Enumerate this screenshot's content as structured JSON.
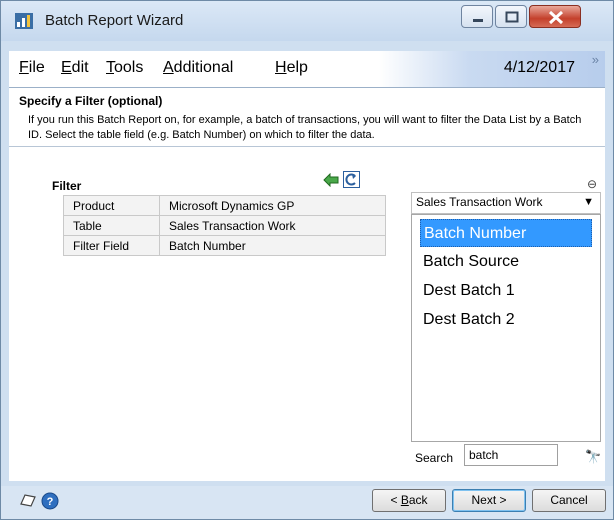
{
  "window": {
    "title": "Batch Report Wizard"
  },
  "menu": {
    "items": [
      {
        "label": "File",
        "u": "F",
        "rest": "ile"
      },
      {
        "label": "Edit",
        "u": "E",
        "rest": "dit"
      },
      {
        "label": "Tools",
        "u": "T",
        "rest": "ools"
      },
      {
        "label": "Additional",
        "u": "A",
        "rest": "dditional"
      },
      {
        "label": "Help",
        "u": "H",
        "rest": "elp"
      }
    ],
    "date": "4/12/2017",
    "overflow": "»"
  },
  "header": {
    "title": "Specify a Filter (optional)",
    "description": "If you run this Batch Report on, for example, a batch of transactions, you will want to filter the Data List by a Batch ID.  Select the table field (e.g. Batch Number) on which to filter the data."
  },
  "filter": {
    "label": "Filter",
    "rows": [
      {
        "label": "Product",
        "value": "Microsoft Dynamics GP"
      },
      {
        "label": "Table",
        "value": "Sales Transaction Work"
      },
      {
        "label": "Filter Field",
        "value": "Batch Number"
      }
    ]
  },
  "table_select": {
    "value": "Sales Transaction Work"
  },
  "fields": {
    "items": [
      "Batch Number",
      "Batch Source",
      "Dest Batch 1",
      "Dest Batch 2"
    ],
    "selected": "Batch Number"
  },
  "search": {
    "label": "Search",
    "value": "batch"
  },
  "buttons": {
    "back_u": "B",
    "back_rest": "ack",
    "back_prefix": "< ",
    "next": "Next >",
    "cancel": "Cancel"
  },
  "colors": {
    "accent": "#3399ff",
    "chrome": "#cfdff0"
  }
}
